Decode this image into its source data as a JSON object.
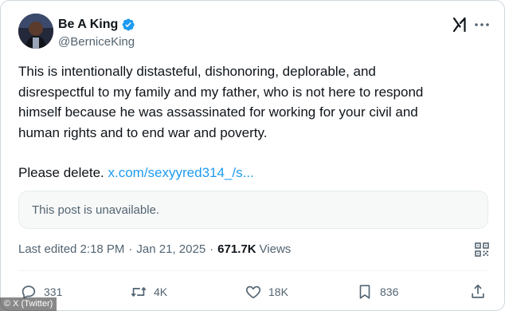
{
  "author": {
    "display_name": "Be A King",
    "handle": "@BerniceKing",
    "verified": true,
    "verified_color": "#1d9bf0"
  },
  "tweet": {
    "lines": [
      "This is intentionally distasteful, dishonoring, deplorable, and",
      "disrespectful to my family and my father, who is not here to respond",
      "himself because he was assassinated for working for your civil and",
      "human rights and to end war and poverty."
    ],
    "closing": "Please delete.",
    "link_text": "x.com/sexyyred314_/s...",
    "link_color": "#1d9bf0"
  },
  "quote": {
    "text": "This post is unavailable."
  },
  "meta": {
    "edited_label": "Last edited 2:18 PM",
    "date": "Jan 21, 2025",
    "separator": "·",
    "views_count": "671.7K",
    "views_label": "Views"
  },
  "actions": {
    "replies": "331",
    "reposts": "4K",
    "likes": "18K",
    "bookmarks": "836"
  },
  "icons": [
    "grok-icon",
    "more-icon",
    "qr-code-icon",
    "reply-icon",
    "repost-icon",
    "like-icon",
    "bookmark-icon",
    "share-icon",
    "verified-badge-icon"
  ],
  "watermark": "© X (Twitter)"
}
